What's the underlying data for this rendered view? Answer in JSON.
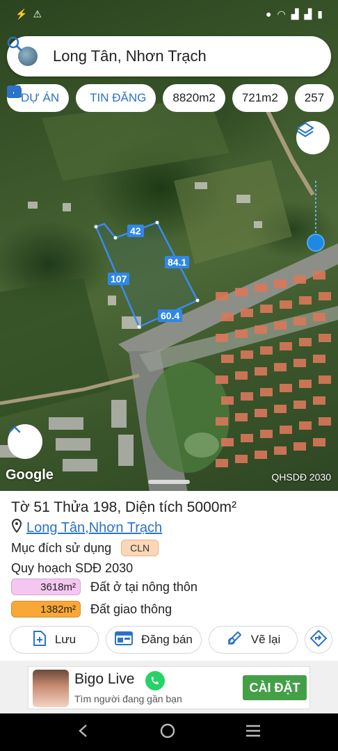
{
  "status_bar": {
    "left_icons": [
      "messenger-icon",
      "alert-icon"
    ],
    "right_icons": [
      "location-icon",
      "wifi-icon",
      "signal-icon",
      "signal-icon",
      "battery-icon"
    ]
  },
  "search": {
    "text": "Long Tân, Nhơn Trạch",
    "icon": "search-icon"
  },
  "chips": [
    {
      "label": "DỰ ÁN",
      "icon": "building-icon"
    },
    {
      "label": "TIN ĐĂNG",
      "icon": "calendar-icon"
    },
    {
      "label": "8820m2"
    },
    {
      "label": "721m2"
    },
    {
      "label": "257"
    }
  ],
  "map": {
    "parcel_dimensions": {
      "top": "42",
      "right": "84.1",
      "left": "107",
      "bottom": "60.4"
    },
    "attribution": "Google",
    "source_label": "QHSDĐ 2030",
    "parcel_outline_color": "#3b8bf0",
    "location_color": "#1e88e5"
  },
  "parcel": {
    "title": "Tờ 51 Thửa 198, Diện tích 5000m²",
    "location_part1": "Long Tân",
    "location_separator": ", ",
    "location_part2": "Nhơn Trạch",
    "purpose_label": "Mục đích sử dụng",
    "purpose_code": "CLN",
    "plan_title": "Quy hoạch SDĐ 2030",
    "zones": [
      {
        "area": "3618m²",
        "name": "Đất ở tại nông thôn",
        "color": "#f4c6f0"
      },
      {
        "area": "1382m²",
        "name": "Đất giao thông",
        "color": "#f9a736"
      }
    ]
  },
  "actions": {
    "save": "Lưu",
    "post": "Đăng bán",
    "redraw": "Vẽ lại"
  },
  "ad": {
    "title": "Bigo Live",
    "subtitle": "Tìm người đang gần bạn",
    "install": "CÀI ĐẶT"
  },
  "colors": {
    "accent": "#2a73c8",
    "cln_badge": "#fbd7b8",
    "install_green": "#43a047"
  }
}
